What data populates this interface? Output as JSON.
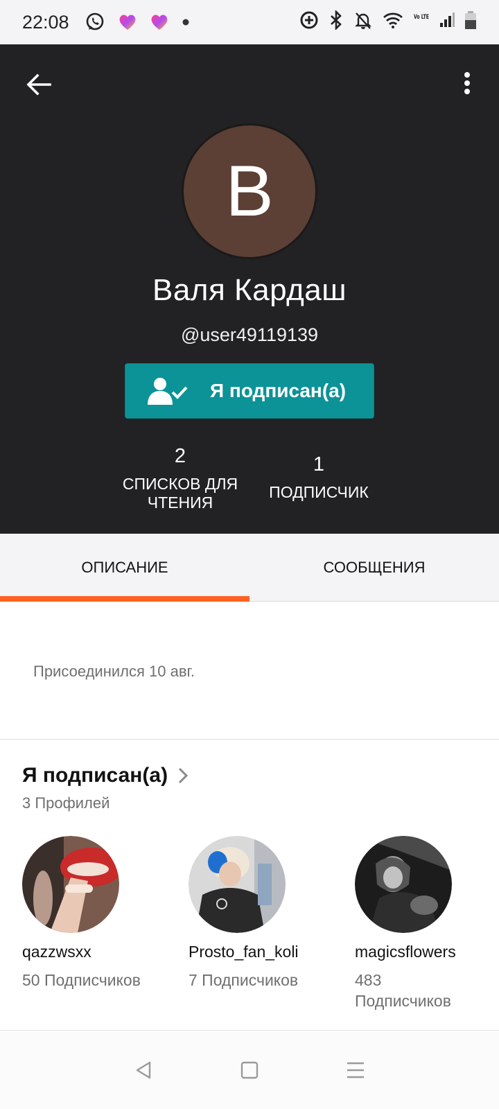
{
  "status_bar": {
    "time": "22:08",
    "icons_left": [
      "whatsapp-icon",
      "heart-app-icon",
      "heart-app-icon",
      "dot-icon"
    ],
    "icons_right": [
      "data-saver-icon",
      "bluetooth-icon",
      "notifications-off-icon",
      "wifi-icon",
      "volte-icon",
      "signal-icon",
      "battery-icon"
    ],
    "volte_label": "Vo LTE"
  },
  "header": {
    "avatar_letter": "В",
    "avatar_color": "#5c3f35",
    "name": "Валя Кардаш",
    "handle": "@user49119139",
    "follow_button_label": "Я подписан(а)",
    "follow_button_color": "#0c9397",
    "stats": {
      "reading_lists_count": "2",
      "reading_lists_label": "СПИСКОВ ДЛЯ ЧТЕНИЯ",
      "followers_count": "1",
      "followers_label": "ПОДПИСЧИК"
    }
  },
  "tabs": [
    {
      "label": "ОПИСАНИЕ",
      "active": true
    },
    {
      "label": "СООБЩЕНИЯ",
      "active": false
    }
  ],
  "accent_color": "#ff6122",
  "about": {
    "joined": "Присоединился 10 авг."
  },
  "following": {
    "title": "Я подписан(а)",
    "count_label": "3 Профилей",
    "profiles": [
      {
        "username": "qazzwsxx",
        "followers": "50 Подписчиков"
      },
      {
        "username": "Prosto_fan_koli",
        "followers": "7 Подписчиков"
      },
      {
        "username": "magicsflowers",
        "followers": "483 Подписчиков"
      }
    ]
  }
}
